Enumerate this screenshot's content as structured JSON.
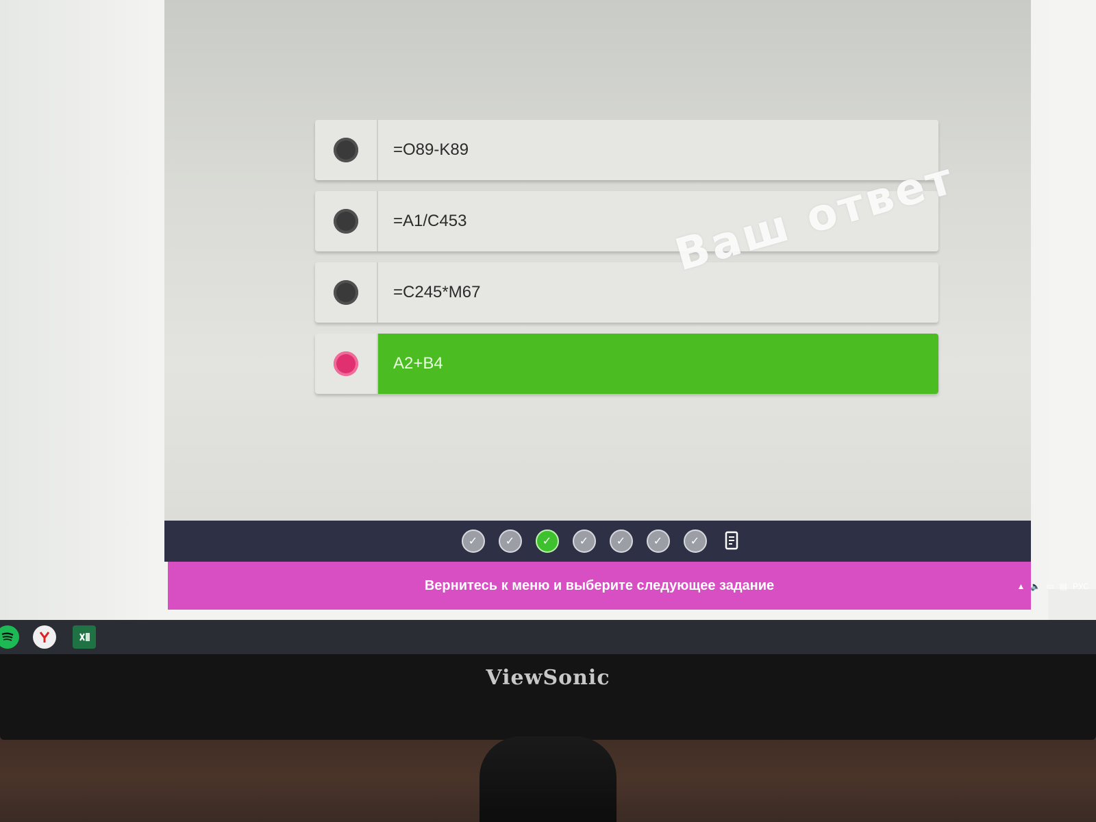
{
  "quiz": {
    "options": [
      {
        "label": "=O89-K89",
        "selected": false,
        "correct": false
      },
      {
        "label": "=A1/C453",
        "selected": false,
        "correct": false
      },
      {
        "label": "=C245*M67",
        "selected": false,
        "correct": false
      },
      {
        "label": "A2+B4",
        "selected": true,
        "correct": true
      }
    ],
    "stamp_text": "Ваш ответ"
  },
  "navigation": {
    "question_count": 7,
    "current_index": 2,
    "check_glyph": "✓",
    "report_icon": "report-icon"
  },
  "footer": {
    "message": "Вернитесь к меню и выберите следующее задание"
  },
  "taskbar": {
    "apps": [
      "spotify-icon",
      "yandex-browser-icon",
      "excel-icon"
    ],
    "tray_lang": "РУС"
  },
  "monitor": {
    "brand": "ViewSonic"
  },
  "colors": {
    "correct_green": "#4bbd22",
    "footer_pink": "#d84fc3",
    "navbar_navy": "#2e3046",
    "selected_radio": "#e0306f"
  }
}
